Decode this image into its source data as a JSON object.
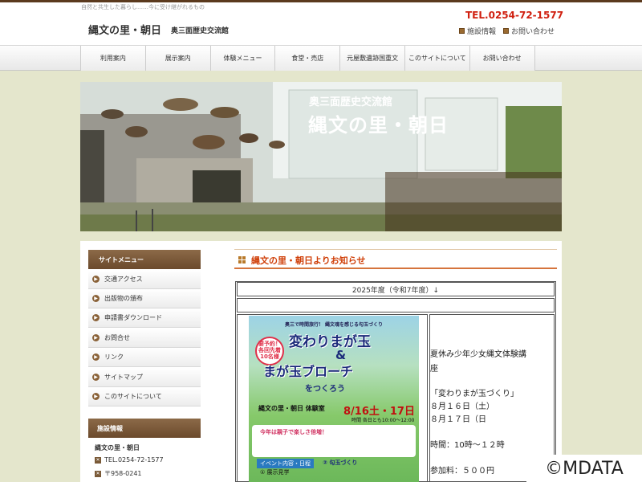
{
  "header": {
    "tagline": "自然と共生した暮らし……今に受け継がれるもの",
    "title": "縄文の里・朝日",
    "subtitle": "奥三面歴史交流館",
    "tel": "TEL.0254-72-1577",
    "links": [
      {
        "label": "施設情報",
        "icon": "square-bullet-icon"
      },
      {
        "label": "お問い合わせ",
        "icon": "square-bullet-icon"
      }
    ]
  },
  "nav": {
    "items": [
      "利用案内",
      "展示案内",
      "体験メニュー",
      "食堂・売店",
      "元屋敷遺跡国重文",
      "このサイトについて",
      "お問い合わせ"
    ]
  },
  "hero": {
    "subtitle": "奥三面歴史交流館",
    "title": "縄文の里・朝日"
  },
  "sidebar": {
    "menu_title": "サイトメニュー",
    "items": [
      "交通アクセス",
      "出版物の頒布",
      "申請書ダウンロード",
      "お問合せ",
      "リンク",
      "サイトマップ",
      "このサイトについて"
    ],
    "facility_title": "施設情報",
    "facility_name": "縄文の里・朝日",
    "facility_tel": "TEL.0254-72-1577",
    "facility_zip": "〒958-0241"
  },
  "main": {
    "news_title": "縄文の里・朝日よりお知らせ",
    "year_row": "2025年度（令和7年度）↓",
    "flyer": {
      "top": "奥三で時間旅行！ 縄文魂を感じる勾玉づくり",
      "badge": "要予約！各回先着10名様",
      "line1": "変わりまが玉",
      "amp": "&",
      "line2": "まが玉ブローチ",
      "line3": "をつくろう",
      "venue": "縄文の里・朝日 体験室",
      "date": "8/16土・17日",
      "time": "時間 各日とも10:00〜12:00",
      "note_title": "今年は親子で楽しさ倍増！",
      "steps": "イベント内容・日程",
      "steps2": "② 勾玉づくり",
      "steps3": "① 展示見学"
    },
    "info_lines": [
      "夏休み少年少女縄文体験講",
      "座",
      "「変わりまが玉づくり」",
      "８月１６日（土）",
      "８月１７日（日",
      "時間：10時～１２時",
      "参加料：５００円"
    ]
  },
  "watermark": "©MDATA"
}
